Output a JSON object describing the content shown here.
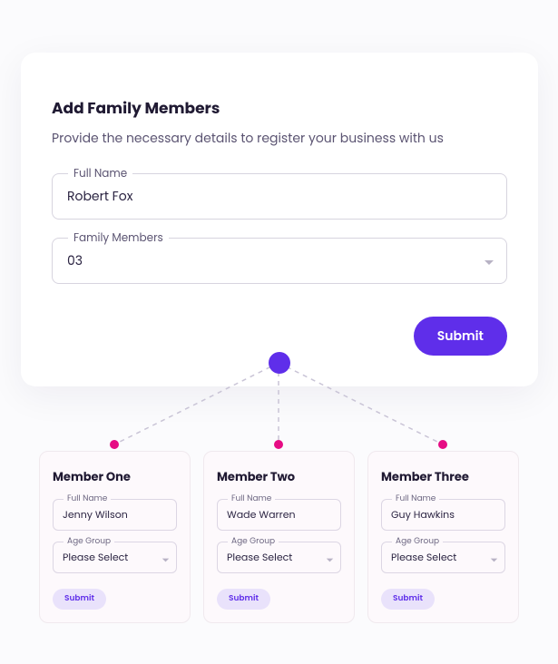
{
  "main": {
    "title": "Add Family Members",
    "subtitle": "Provide the necessary details to register your business with us",
    "fullNameLabel": "Full Name",
    "fullNameValue": "Robert Fox",
    "familyMembersLabel": "Family Members",
    "familyMembersValue": "03",
    "submit": "Submit"
  },
  "members": [
    {
      "title": "Member One",
      "fullNameLabel": "Full Name",
      "fullNameValue": "Jenny Wilson",
      "ageGroupLabel": "Age Group",
      "ageGroupValue": "Please Select",
      "submit": "Submit"
    },
    {
      "title": "Member Two",
      "fullNameLabel": "Full Name",
      "fullNameValue": "Wade Warren",
      "ageGroupLabel": "Age Group",
      "ageGroupValue": "Please Select",
      "submit": "Submit"
    },
    {
      "title": "Member Three",
      "fullNameLabel": "Full Name",
      "fullNameValue": "Guy Hawkins",
      "ageGroupLabel": "Age Group",
      "ageGroupValue": "Please Select",
      "submit": "Submit"
    }
  ]
}
